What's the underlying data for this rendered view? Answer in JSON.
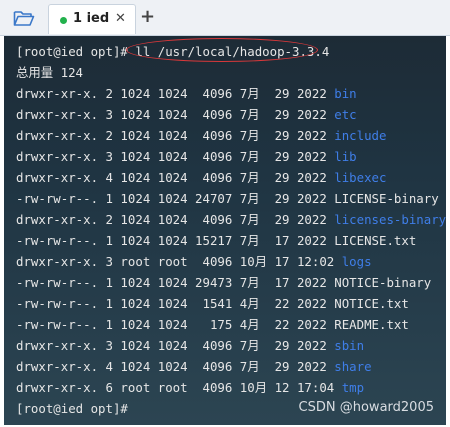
{
  "tab": {
    "label": "1 ied",
    "close": "✕"
  },
  "new_tab": "+",
  "terminal": {
    "lines": [
      {
        "kind": "prompt",
        "prompt": "[root@ied opt]# ",
        "command": "ll /usr/local/hadoop-3.3.4"
      },
      {
        "kind": "text",
        "text": "总用量 124"
      },
      {
        "kind": "entry",
        "meta": "drwxr-xr-x. 2 1024 1024  4096 7月  29 2022 ",
        "name": "bin",
        "is_dir": true
      },
      {
        "kind": "entry",
        "meta": "drwxr-xr-x. 3 1024 1024  4096 7月  29 2022 ",
        "name": "etc",
        "is_dir": true
      },
      {
        "kind": "entry",
        "meta": "drwxr-xr-x. 2 1024 1024  4096 7月  29 2022 ",
        "name": "include",
        "is_dir": true
      },
      {
        "kind": "entry",
        "meta": "drwxr-xr-x. 3 1024 1024  4096 7月  29 2022 ",
        "name": "lib",
        "is_dir": true
      },
      {
        "kind": "entry",
        "meta": "drwxr-xr-x. 4 1024 1024  4096 7月  29 2022 ",
        "name": "libexec",
        "is_dir": true
      },
      {
        "kind": "entry",
        "meta": "-rw-rw-r--. 1 1024 1024 24707 7月  29 2022 ",
        "name": "LICENSE-binary",
        "is_dir": false
      },
      {
        "kind": "entry",
        "meta": "drwxr-xr-x. 2 1024 1024  4096 7月  29 2022 ",
        "name": "licenses-binary",
        "is_dir": true
      },
      {
        "kind": "entry",
        "meta": "-rw-rw-r--. 1 1024 1024 15217 7月  17 2022 ",
        "name": "LICENSE.txt",
        "is_dir": false
      },
      {
        "kind": "entry",
        "meta": "drwxr-xr-x. 3 root root  4096 10月 17 12:02 ",
        "name": "logs",
        "is_dir": true
      },
      {
        "kind": "entry",
        "meta": "-rw-rw-r--. 1 1024 1024 29473 7月  17 2022 ",
        "name": "NOTICE-binary",
        "is_dir": false
      },
      {
        "kind": "entry",
        "meta": "-rw-rw-r--. 1 1024 1024  1541 4月  22 2022 ",
        "name": "NOTICE.txt",
        "is_dir": false
      },
      {
        "kind": "entry",
        "meta": "-rw-rw-r--. 1 1024 1024   175 4月  22 2022 ",
        "name": "README.txt",
        "is_dir": false
      },
      {
        "kind": "entry",
        "meta": "drwxr-xr-x. 3 1024 1024  4096 7月  29 2022 ",
        "name": "sbin",
        "is_dir": true
      },
      {
        "kind": "entry",
        "meta": "drwxr-xr-x. 4 1024 1024  4096 7月  29 2022 ",
        "name": "share",
        "is_dir": true
      },
      {
        "kind": "entry",
        "meta": "drwxr-xr-x. 6 root root  4096 10月 12 17:04 ",
        "name": "tmp",
        "is_dir": true
      },
      {
        "kind": "prompt",
        "prompt": "[root@ied opt]#",
        "command": ""
      }
    ]
  },
  "watermark": "CSDN @howard2005",
  "colors": {
    "directory": "#3f7ee8",
    "text": "#e6e6e6",
    "annotation": "#d9383a",
    "tab_dot": "#22b14c"
  },
  "icons": {
    "toolbar": "folder-open-icon"
  }
}
